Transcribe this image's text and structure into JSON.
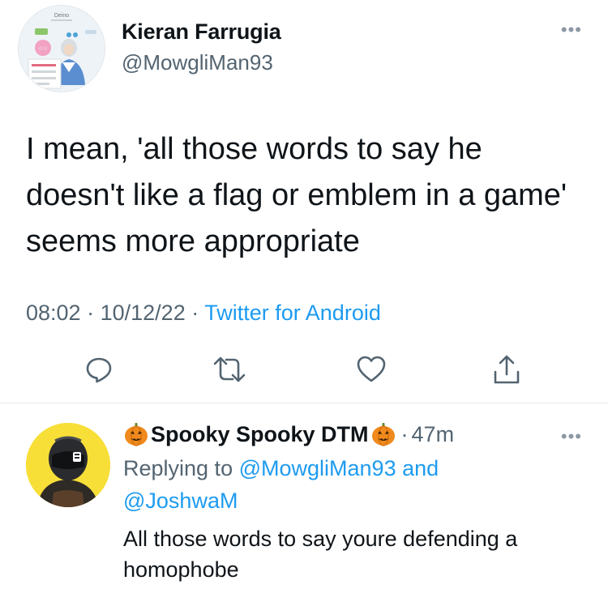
{
  "main_tweet": {
    "author_name": "Kieran Farrugia",
    "author_handle": "@MowgliMan93",
    "avatar_icon": "game-profile-avatar-icon",
    "avatar_header_text": "Deino",
    "text": "I mean, 'all those words to say he doesn't like a flag or emblem in a game' seems more appropriate",
    "time": "08:02",
    "date": "10/12/22",
    "separator": "·",
    "source": "Twitter for Android",
    "more_label": "•••",
    "actions": [
      "reply-icon",
      "retweet-icon",
      "like-icon",
      "share-icon"
    ]
  },
  "reply": {
    "author_name": "Spooky Spooky DTM",
    "name_emoji": "pumpkin-icon",
    "time": "47m",
    "separator": "·",
    "more_label": "•••",
    "replying_prefix": "Replying to",
    "mention_1": "@MowgliMan93",
    "mention_joiner": "and",
    "mention_2": "@JoshwaM",
    "text": "All those words to say youre defending a homophobe",
    "avatar_icon": "helmet-avatar-icon"
  },
  "colors": {
    "text": "#0f1419",
    "secondary": "#536471",
    "link": "#1d9bf0",
    "icon": "#536471",
    "divider": "#e6e9ec",
    "reply_avatar_bg": "#f7df38"
  }
}
